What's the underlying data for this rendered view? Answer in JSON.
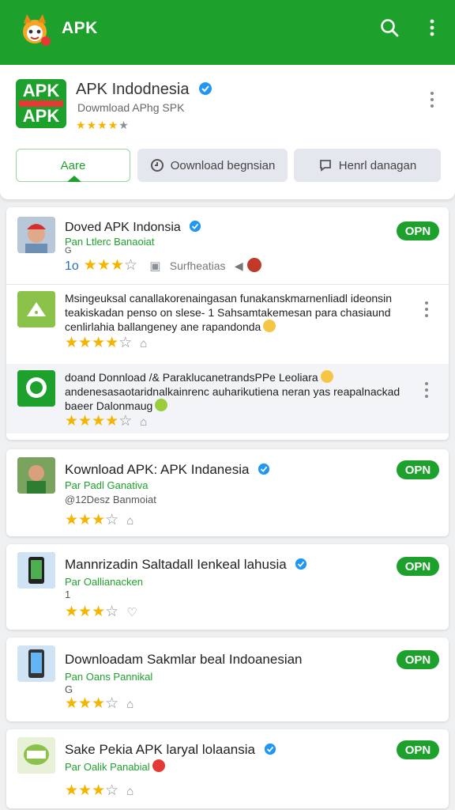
{
  "appbar": {
    "title": "APK",
    "color": "#1ea12c",
    "icons": [
      "mascot-logo-icon",
      "search-icon",
      "more-vert-icon"
    ]
  },
  "header": {
    "logo_text": [
      "APK",
      "APK"
    ],
    "name": "APK Indodnesia",
    "subtitle": "Dowmload APhg SPK",
    "rating_stars": "★★★★★",
    "buttons": [
      {
        "label": "Aare",
        "icon": ""
      },
      {
        "label": "Oownload begnsian",
        "icon": "clock-icon"
      },
      {
        "label": "Henrl danagan",
        "icon": "chat-icon"
      }
    ]
  },
  "card1": {
    "item1": {
      "title": "Doved APK Indonsia",
      "sub": "Pan Ltlerc Banaoiat",
      "sub2": "G",
      "count": "1o",
      "meta": "Surfheatias",
      "open_label": "OPN"
    },
    "item2": {
      "desc": [
        "Msingeuksal canallakorenaingasan funakanskmarnenliadl ideonsin",
        "teakiskadan penso on slese- 1 Sahsamtakemesan para chasiaund",
        "cenlirlahia ballangeney ane rapandonda"
      ]
    },
    "item3": {
      "desc": [
        "doand Donnload /& ParaklucanetrandsPPe Leoliara",
        "andenesasaotaridnalkainrenc auharikutiena neran yas reapalnackad",
        "baeer Dalonmaug"
      ]
    }
  },
  "items": [
    {
      "title": "Kownload APK: APK Indanesia",
      "sub": "Par Padl Ganativa",
      "sub2": "@12Desz Banmoiat",
      "open_label": "OPN"
    },
    {
      "title": "Mannrizadin Saltadall Ienkeal lahusia",
      "sub": "Par Oallianacken",
      "sub2": "1",
      "open_label": "OPN"
    },
    {
      "title": "Downloadam Sakmlar beal Indoanesian",
      "sub": "Pan Oans Pannikal",
      "sub2": "G",
      "open_label": "OPN"
    },
    {
      "title": "Sake Pekia APK laryal lolaansia",
      "sub": "Par Oalik Panabial",
      "sub2": "",
      "open_label": "OPN"
    }
  ],
  "ratings": {
    "full_star": "★",
    "empty_star": "☆"
  }
}
